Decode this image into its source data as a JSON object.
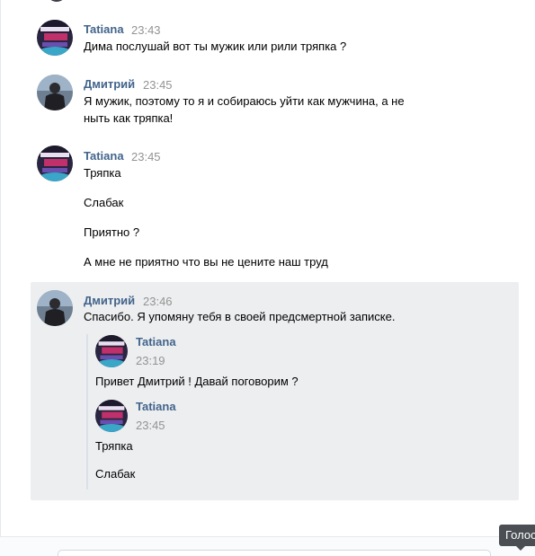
{
  "messages": [
    {
      "author": "Tatiana",
      "time": "23:43",
      "lines": [
        "Дима послушай вот ты мужик или рили тряпка ?"
      ],
      "avatar": "tatiana-avatar"
    },
    {
      "author": "Дмитрий",
      "time": "23:45",
      "lines": [
        "Я мужик, поэтому то я и собираюсь уйти как мужчина, а не",
        "ныть как тряпка!"
      ],
      "avatar": "dmitry-avatar"
    },
    {
      "author": "Tatiana",
      "time": "23:45",
      "lines": [
        "Тряпка",
        "Слабак",
        "Приятно ?",
        "А мне не приятно что вы не цените наш труд"
      ],
      "avatar": "tatiana-avatar"
    },
    {
      "author": "Дмитрий",
      "time": "23:46",
      "lines": [
        "Спасибо. Я упомяну тебя в своей предсмертной записке."
      ],
      "avatar": "dmitry-avatar",
      "selected": true,
      "forwarded": [
        {
          "author": "Tatiana",
          "time": "23:19",
          "lines": [
            "Привет Дмитрий ! Давай поговорим ?"
          ]
        },
        {
          "author": "Tatiana",
          "time": "23:45",
          "lines": [
            "Тряпка",
            "Слабак"
          ]
        }
      ]
    }
  ],
  "tooltip": {
    "label": "Голос"
  },
  "colors": {
    "author_link": "#42648b",
    "timestamp": "#939393",
    "selected_bg": "#edeef0",
    "tooltip_bg": "#4b4f54"
  }
}
